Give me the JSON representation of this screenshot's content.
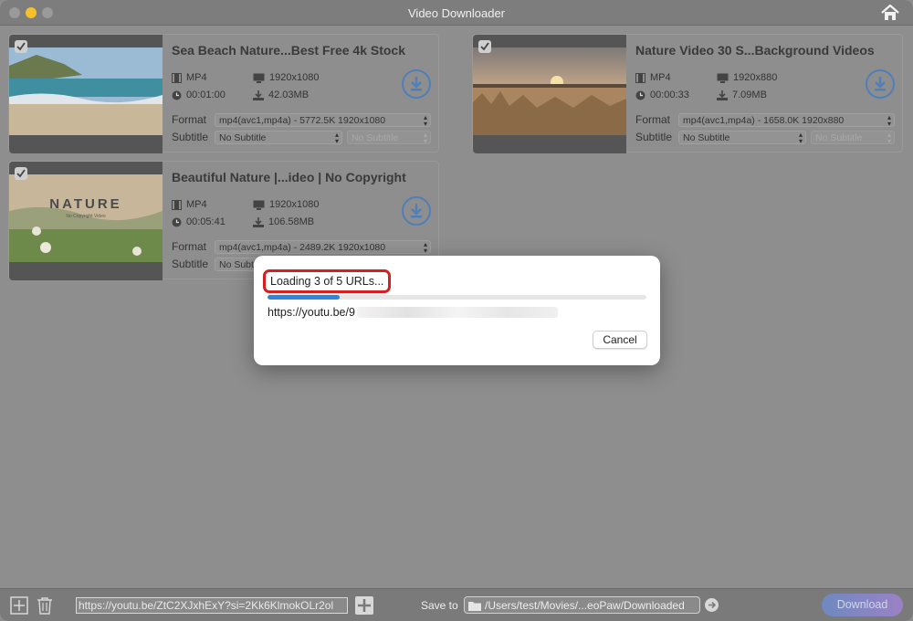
{
  "window": {
    "title": "Video Downloader"
  },
  "videos": [
    {
      "title": "Sea Beach Nature...Best Free 4k Stock",
      "container": "MP4",
      "resolution": "1920x1080",
      "duration": "00:01:00",
      "size": "42.03MB",
      "format_label": "Format",
      "format_value": "mp4(avc1,mp4a) - 5772.5K 1920x1080",
      "subtitle_label": "Subtitle",
      "subtitle_value": "No Subtitle",
      "subtitle_lang_value": "No Subtitle",
      "checked": true
    },
    {
      "title": "Nature Video 30 S...Background Videos",
      "container": "MP4",
      "resolution": "1920x880",
      "duration": "00:00:33",
      "size": "7.09MB",
      "format_label": "Format",
      "format_value": "mp4(avc1,mp4a) - 1658.0K 1920x880",
      "subtitle_label": "Subtitle",
      "subtitle_value": "No Subtitle",
      "subtitle_lang_value": "No Subtitle",
      "checked": true
    },
    {
      "title": "Beautiful Nature |...ideo | No Copyright",
      "container": "MP4",
      "resolution": "1920x1080",
      "duration": "00:05:41",
      "size": "106.58MB",
      "format_label": "Format",
      "format_value": "mp4(avc1,mp4a) - 2489.2K 1920x1080",
      "subtitle_label": "Subtitle",
      "subtitle_value": "No Subt",
      "thumb_text": "NATURE",
      "thumb_subtext": "No Copyright Video",
      "checked": true
    }
  ],
  "dialog": {
    "loading_text": "Loading 3 of 5 URLs...",
    "progress_fraction": 0.19,
    "current_url": "https://youtu.be/9",
    "cancel_label": "Cancel"
  },
  "bottom": {
    "url_input_value": "https://youtu.be/ZtC2XJxhExY?si=2Kk6KlmokOLr2ol",
    "save_to_label": "Save to",
    "save_path": "/Users/test/Movies/...eoPaw/Downloaded",
    "download_label": "Download"
  },
  "colors": {
    "accent": "#2f84e0",
    "highlight": "#d42020",
    "download_gradient_start": "#6f89c0",
    "download_gradient_end": "#9a82c4"
  }
}
